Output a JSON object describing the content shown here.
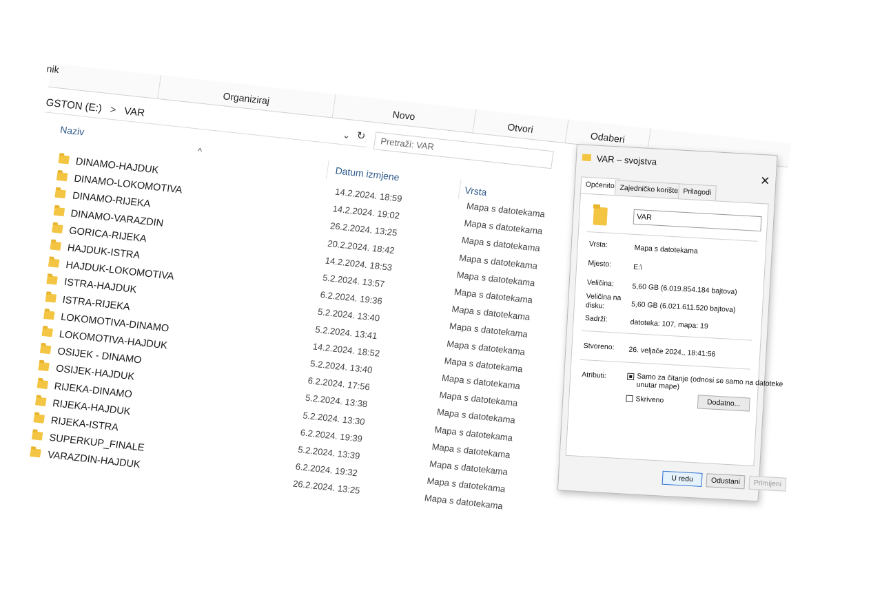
{
  "explorer": {
    "ribbon": {
      "partial_tab": "nik",
      "groups": [
        "Organiziraj",
        "Novo",
        "Otvori",
        "Odaberi"
      ]
    },
    "address": {
      "drive": "GSTON (E:)",
      "separator": ">",
      "folder": "VAR"
    },
    "search_placeholder": "Pretraži: VAR",
    "columns": {
      "name": "Naziv",
      "date": "Datum izmjene",
      "type": "Vrsta"
    },
    "rows": [
      {
        "name": "DINAMO-HAJDUK",
        "date": "14.2.2024. 18:59",
        "type": "Mapa s datotekama"
      },
      {
        "name": "DINAMO-LOKOMOTIVA",
        "date": "14.2.2024. 19:02",
        "type": "Mapa s datotekama"
      },
      {
        "name": "DINAMO-RIJEKA",
        "date": "26.2.2024. 13:25",
        "type": "Mapa s datotekama"
      },
      {
        "name": "DINAMO-VARAZDIN",
        "date": "20.2.2024. 18:42",
        "type": "Mapa s datotekama"
      },
      {
        "name": "GORICA-RIJEKA",
        "date": "14.2.2024. 18:53",
        "type": "Mapa s datotekama"
      },
      {
        "name": "HAJDUK-ISTRA",
        "date": "5.2.2024. 13:57",
        "type": "Mapa s datotekama"
      },
      {
        "name": "HAJDUK-LOKOMOTIVA",
        "date": "6.2.2024. 19:36",
        "type": "Mapa s datotekama"
      },
      {
        "name": "ISTRA-HAJDUK",
        "date": "5.2.2024. 13:40",
        "type": "Mapa s datotekama"
      },
      {
        "name": "ISTRA-RIJEKA",
        "date": "5.2.2024. 13:41",
        "type": "Mapa s datotekama"
      },
      {
        "name": "LOKOMOTIVA-DINAMO",
        "date": "14.2.2024. 18:52",
        "type": "Mapa s datotekama"
      },
      {
        "name": "LOKOMOTIVA-HAJDUK",
        "date": "5.2.2024. 13:40",
        "type": "Mapa s datotekama"
      },
      {
        "name": "OSIJEK - DINAMO",
        "date": "6.2.2024. 17:56",
        "type": "Mapa s datotekama"
      },
      {
        "name": "OSIJEK-HAJDUK",
        "date": "5.2.2024. 13:38",
        "type": "Mapa s datotekama"
      },
      {
        "name": "RIJEKA-DINAMO",
        "date": "5.2.2024. 13:30",
        "type": "Mapa s datotekama"
      },
      {
        "name": "RIJEKA-HAJDUK",
        "date": "6.2.2024. 19:39",
        "type": "Mapa s datotekama"
      },
      {
        "name": "RIJEKA-ISTRA",
        "date": "5.2.2024. 13:39",
        "type": "Mapa s datotekama"
      },
      {
        "name": "SUPERKUP_FINALE",
        "date": "6.2.2024. 19:32",
        "type": "Mapa s datotekama"
      },
      {
        "name": "VARAZDIN-HAJDUK",
        "date": "26.2.2024. 13:25",
        "type": "Mapa s datotekama"
      }
    ]
  },
  "dialog": {
    "title": "VAR – svojstva",
    "tabs": [
      "Općenito",
      "Zajedničko korištenje",
      "Prilagodi"
    ],
    "name_value": "VAR",
    "fields": {
      "type_label": "Vrsta:",
      "type_value": "Mapa s datotekama",
      "location_label": "Mjesto:",
      "location_value": "E:\\",
      "size_label": "Veličina:",
      "size_value": "5,60 GB (6.019.854.184 bajtova)",
      "disk_size_label_1": "Veličina na",
      "disk_size_label_2": "disku:",
      "disk_size_value": "5,60 GB (6.021.611.520 bajtova)",
      "contains_label": "Sadrži:",
      "contains_value": "datoteka: 107, mapa: 19",
      "created_label": "Stvoreno:",
      "created_value": "26. veljače 2024., 18:41:56",
      "attributes_label": "Atributi:",
      "readonly_line1": "Samo za čitanje (odnosi se samo na datoteke",
      "readonly_line2": "unutar mape)",
      "hidden_label": "Skriveno",
      "advanced_button": "Dodatno..."
    },
    "buttons": {
      "ok": "U redu",
      "cancel": "Odustani",
      "apply": "Primijeni"
    }
  }
}
